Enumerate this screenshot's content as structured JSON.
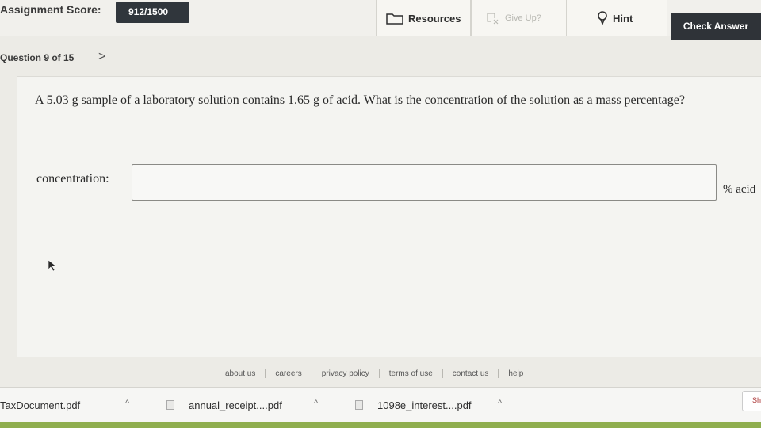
{
  "header": {
    "score_label": "Assignment Score:",
    "score_value": "912/1500",
    "resources_label": "Resources",
    "giveup_label": "Give Up?",
    "hint_label": "Hint",
    "check_label": "Check Answer"
  },
  "question_nav": {
    "label": "Question 9 of 15",
    "next_glyph": ">"
  },
  "question": {
    "text": "A 5.03 g sample of a laboratory solution contains 1.65 g of acid. What is the concentration of the solution as a mass percentage?",
    "field_label": "concentration:",
    "field_value": "",
    "unit": "% acid"
  },
  "footer_links": [
    "about us",
    "careers",
    "privacy policy",
    "terms of use",
    "contact us",
    "help"
  ],
  "downloads": [
    {
      "name": "TaxDocument.pdf"
    },
    {
      "name": "annual_receipt....pdf"
    },
    {
      "name": "1098e_interest....pdf"
    }
  ],
  "show_all_label": "Sh",
  "colors": {
    "accent_dark": "#2f3338",
    "taskbar": "#8fae4e"
  }
}
